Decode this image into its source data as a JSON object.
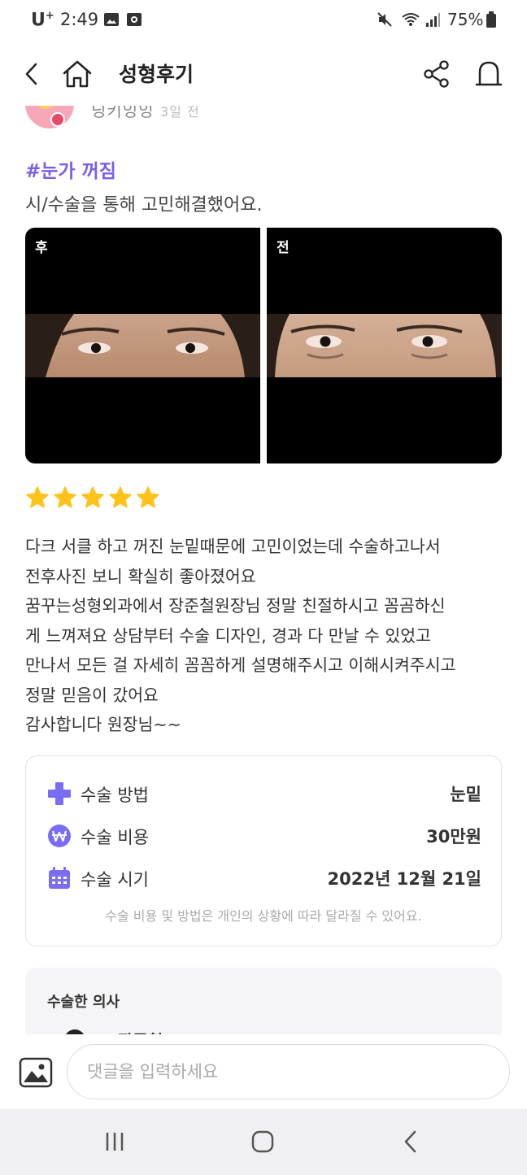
{
  "status": {
    "carrier": "U",
    "carrier_sup": "+",
    "time": "2:49",
    "battery": "75%"
  },
  "header": {
    "title": "성형후기",
    "icons": [
      "back-arrow-icon",
      "home-icon",
      "share-icon",
      "alarm-icon"
    ]
  },
  "author": {
    "name": "닝키잉잉",
    "time_ago": "3일 전"
  },
  "post": {
    "tag": "#눈가 꺼짐",
    "tag_sub": "시/수술을 통해 고민해결했어요.",
    "photo_after_label": "후",
    "photo_before_label": "전",
    "rating": 5,
    "review_lines": [
      "다크 서클 하고 꺼진 눈밑때문에 고민이었는데  수술하고나서",
      "전후사진 보니 확실히 좋아졌어요",
      "꿈꾸는성형외과에서 장준철원장님 정말 친절하시고 꼼곰하신",
      "게 느껴져요 상담부터 수술 디자인, 경과 다 만날 수 있었고",
      "만나서 모든 걸 자세히 꼼꼼하게 설명해주시고 이해시켜주시고",
      "정말 믿음이 갔어요",
      "감사합니다 원장님~~"
    ]
  },
  "info": {
    "method_label": "수술 방법",
    "method_value": "눈밑",
    "cost_label": "수술 비용",
    "cost_value": "30만원",
    "date_label": "수술 시기",
    "date_value": "2022년 12월 21일",
    "note": "수술 비용 및 방법은 개인의 상황에 따라 달라질 수 있어요.",
    "accent_color": "#7b6cf6"
  },
  "doctor": {
    "title": "수술한 의사",
    "name": "장준철"
  },
  "comment": {
    "placeholder": "댓글을 입력하세요"
  },
  "colors": {
    "tag": "#7b5cf0",
    "star": "#ffc21a"
  }
}
